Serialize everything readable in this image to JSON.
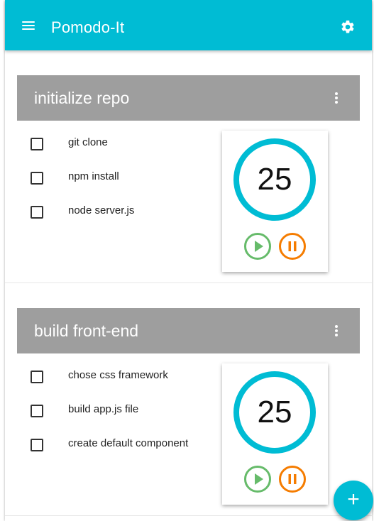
{
  "app": {
    "title": "Pomodo-It",
    "menu_icon": "hamburger-menu-icon",
    "settings_icon": "gear-icon",
    "accent_color": "#00bcd4"
  },
  "tasks": [
    {
      "title": "initialize repo",
      "menu_icon": "more-vert-icon",
      "items": [
        "git clone",
        "npm install",
        "node server.js"
      ],
      "timer": {
        "minutes": "25",
        "play_icon": "play-icon",
        "pause_icon": "pause-icon"
      }
    },
    {
      "title": "build front-end",
      "menu_icon": "more-vert-icon",
      "items": [
        "chose css framework",
        "build app.js file",
        "create default component"
      ],
      "timer": {
        "minutes": "25",
        "play_icon": "play-icon",
        "pause_icon": "pause-icon"
      }
    }
  ],
  "fab": {
    "label": "+",
    "icon": "add-icon"
  }
}
